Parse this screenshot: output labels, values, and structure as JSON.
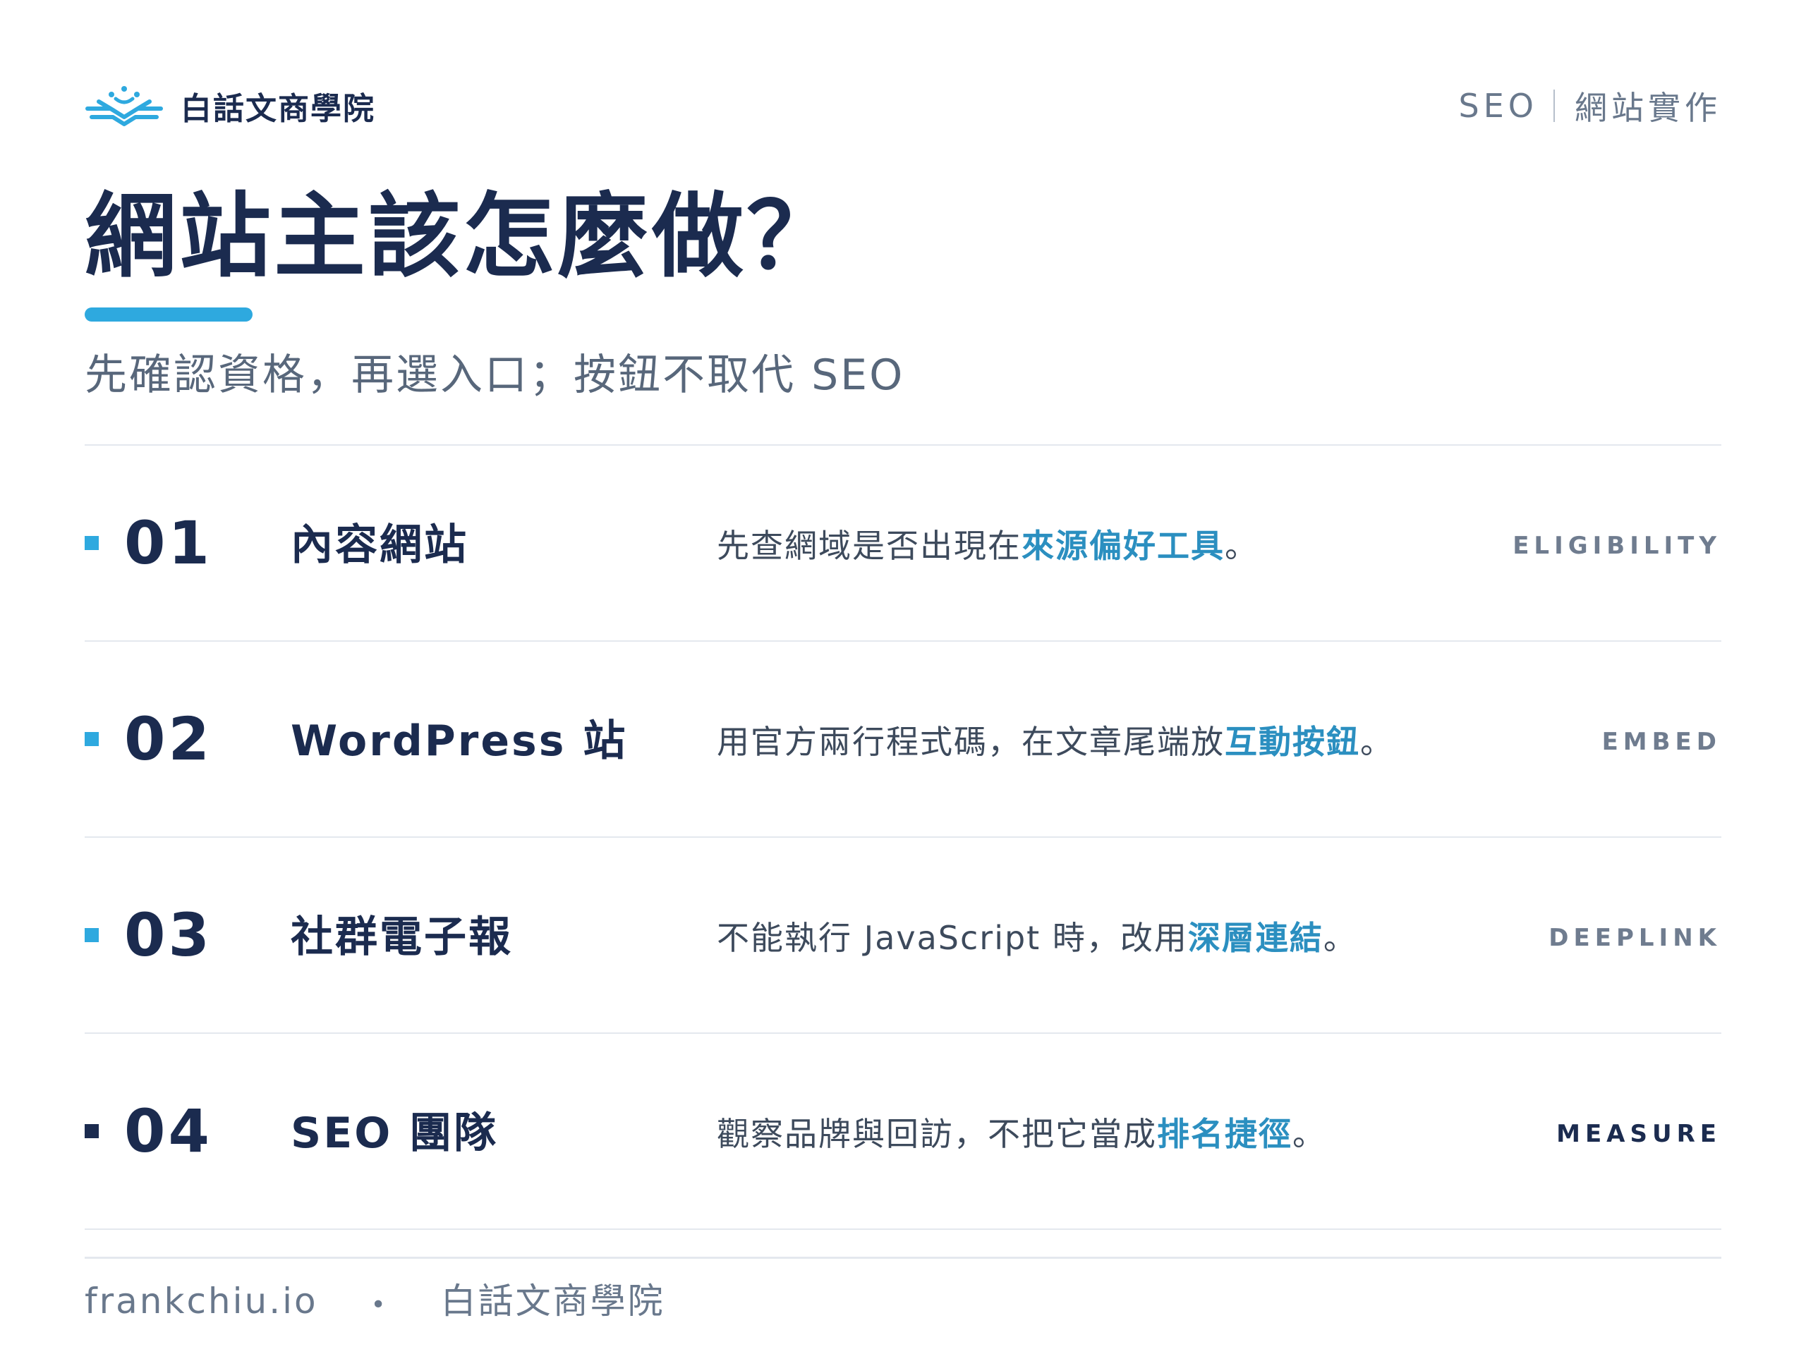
{
  "header": {
    "brand_name": "白話文商學院",
    "brand_logo_icon": "open-book-logo-icon",
    "topic_primary": "SEO",
    "topic_secondary": "網站實作"
  },
  "title": "網站主該怎麼做？",
  "subtitle": "先確認資格，再選入口；按鈕不取代 SEO",
  "rows": [
    {
      "number": "01",
      "name": "內容網站",
      "desc_before": "先查網域是否出現在",
      "desc_highlight": "來源偏好工具",
      "desc_after": "。",
      "tag": "ELIGIBILITY"
    },
    {
      "number": "02",
      "name": "WordPress 站",
      "desc_before": "用官方兩行程式碼，在文章尾端放",
      "desc_highlight": "互動按鈕",
      "desc_after": "。",
      "tag": "EMBED"
    },
    {
      "number": "03",
      "name": "社群電子報",
      "desc_before": "不能執行 JavaScript 時，改用",
      "desc_highlight": "深層連結",
      "desc_after": "。",
      "tag": "DEEPLINK"
    },
    {
      "number": "04",
      "name": "SEO 團隊",
      "desc_before": "觀察品牌與回訪，不把它當成",
      "desc_highlight": "排名捷徑",
      "desc_after": "。",
      "tag": "MEASURE"
    }
  ],
  "footer": {
    "site": "frankchiu.io",
    "separator": "•",
    "brand": "白話文商學院"
  },
  "colors": {
    "navy": "#1b2b4f",
    "accent_blue": "#2ea9df",
    "highlight_blue": "#2b8fc0",
    "muted_gray": "#69788c",
    "rule_gray": "#e4e8ee"
  }
}
